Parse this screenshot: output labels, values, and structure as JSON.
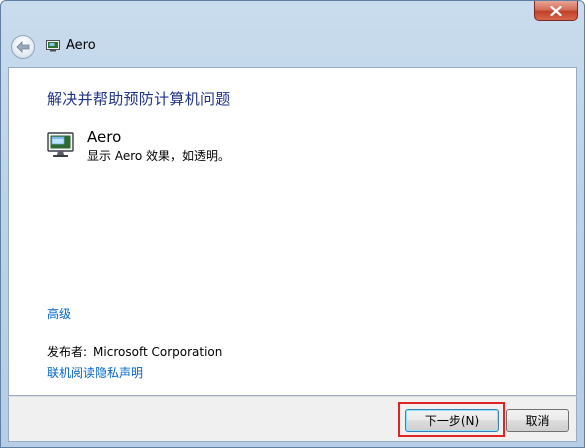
{
  "window": {
    "title": "Aero",
    "close_icon": "close-icon",
    "back_icon": "back-arrow-icon"
  },
  "main": {
    "heading": "解决并帮助预防计算机问题",
    "item": {
      "icon": "aero-display-icon",
      "title": "Aero",
      "description": "显示 Aero 效果，如透明。"
    },
    "advanced_link": "高级",
    "publisher": {
      "label": "发布者:",
      "value": "Microsoft Corporation"
    },
    "privacy_link": "联机阅读隐私声明"
  },
  "footer": {
    "next_label": "下一步(N)",
    "cancel_label": "取消"
  },
  "colors": {
    "heading": "#1e3287",
    "link": "#0066cc",
    "highlight": "#e02424",
    "close_button": "#c1402a"
  }
}
